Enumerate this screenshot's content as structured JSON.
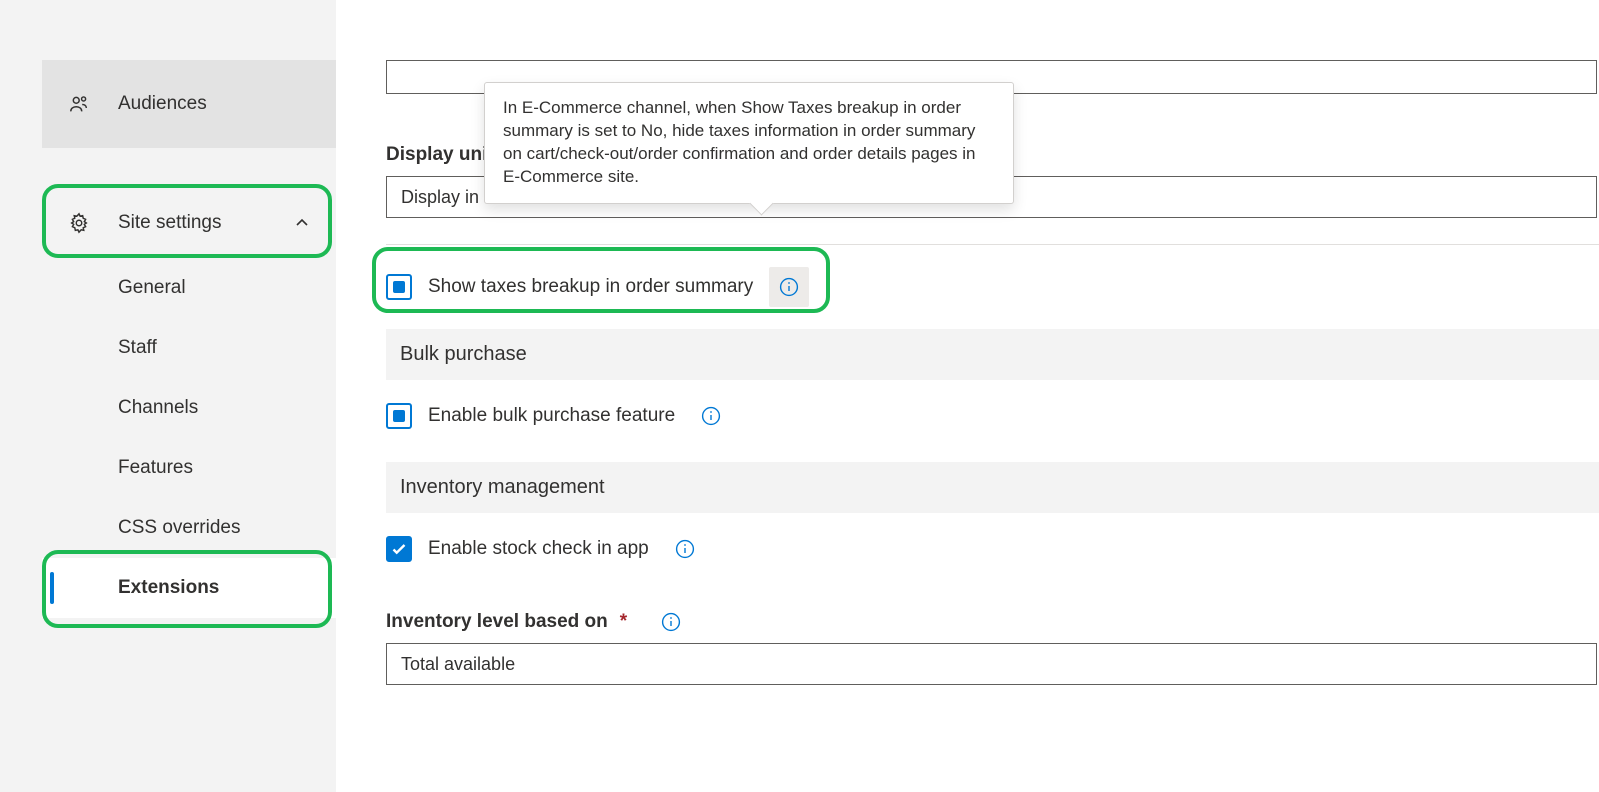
{
  "sidebar": {
    "audiences": "Audiences",
    "site_settings": "Site settings",
    "items": {
      "general": "General",
      "staff": "Staff",
      "channels": "Channels",
      "features": "Features",
      "css_overrides": "CSS overrides",
      "extensions": "Extensions"
    }
  },
  "main": {
    "display_unit_label": "Display unit of ",
    "display_unit_value": "Display in the ",
    "tooltip_text": "In E-Commerce channel, when Show Taxes breakup in order summary is set to No, hide taxes information in order summary on cart/check-out/order confirmation and order details pages in E-Commerce site.",
    "show_taxes_label": "Show taxes breakup in order summary",
    "bulk_purchase_header": "Bulk purchase",
    "enable_bulk_label": "Enable bulk purchase feature",
    "inventory_header": "Inventory management",
    "enable_stock_label": "Enable stock check in app",
    "inventory_level_label": "Inventory level based on",
    "inventory_level_value": "Total available"
  }
}
